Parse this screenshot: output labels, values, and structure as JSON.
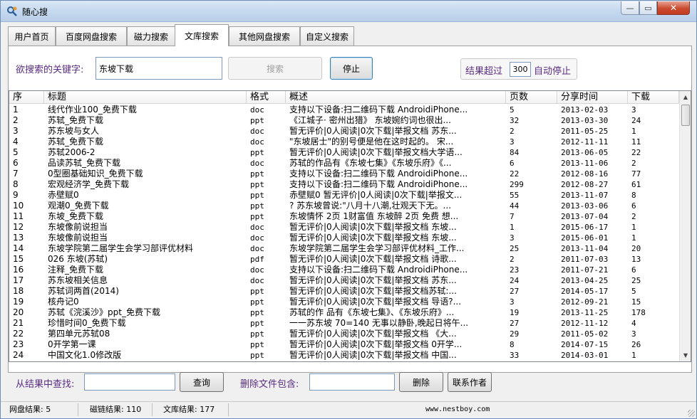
{
  "window": {
    "title": "随心搜",
    "controls": {
      "minimize": "—",
      "maximize": "▭",
      "close": "✕"
    }
  },
  "tabs": [
    {
      "label": "用户首页",
      "active": false
    },
    {
      "label": "百度网盘搜索",
      "active": false
    },
    {
      "label": "磁力搜索",
      "active": false
    },
    {
      "label": "文库搜索",
      "active": true
    },
    {
      "label": "其他网盘搜索",
      "active": false
    },
    {
      "label": "自定义搜索",
      "active": false
    }
  ],
  "search": {
    "label": "欲搜索的关键字:",
    "value": "东坡下载",
    "search_button": "搜索",
    "stop_button": "停止",
    "limit_prefix": "结果超过",
    "limit_value": "300",
    "limit_suffix": "自动停止"
  },
  "grid": {
    "columns": [
      "序",
      "标题",
      "格式",
      "概述",
      "页数",
      "分享时间",
      "下载"
    ],
    "rows": [
      [
        "1",
        "线代作业100_免费下载",
        "doc",
        "支持以下设备:扫二维码下载 AndroidiPhone...",
        "5",
        "2013-02-03",
        "3"
      ],
      [
        "2",
        "苏轼_免费下载",
        "ppt",
        "《江城子· 密州出猎》 东坡婉约词也很出...",
        "32",
        "2013-03-30",
        "24"
      ],
      [
        "3",
        "苏东坡与女人",
        "doc",
        "暂无评价|0人阅读|0次下载|举报文档 苏东...",
        "2",
        "2011-05-25",
        "1"
      ],
      [
        "4",
        "苏轼_免费下载",
        "doc",
        "\"东坡居士\"的别号便是他在这时起的。 宋...",
        "3",
        "2012-11-11",
        "11"
      ],
      [
        "5",
        "苏轼2006-2",
        "ppt",
        "暂无评价|0人阅读|0次下载|举报文档大学语...",
        "84",
        "2013-06-05",
        "22"
      ],
      [
        "6",
        "品读苏轼_免费下载",
        "doc",
        "苏轼的作品有《东坡七集》《东坡乐府》《...",
        "6",
        "2013-11-06",
        "2"
      ],
      [
        "7",
        "0型圈基础知识_免费下载",
        "ppt",
        "支持以下设备:扫二维码下载 AndroidiPhone...",
        "22",
        "2012-08-16",
        "77"
      ],
      [
        "8",
        "宏观经济学_免费下载",
        "ppt",
        "支持以下设备:扫二维码下载 AndroidiPhone...",
        "299",
        "2012-08-27",
        "61"
      ],
      [
        "9",
        "赤壁赋0",
        "ppt",
        "赤壁赋0 暂无评价|0人阅读|0次下载|举报文...",
        "55",
        "2013-11-07",
        "8"
      ],
      [
        "10",
        "观潮0_免费下载",
        "ppt",
        "? 苏东坡曾说:\"八月十八潮,壮观天下无。...",
        "44",
        "2013-03-06",
        "6"
      ],
      [
        "11",
        "东坡_免费下载",
        "ppt",
        "东坡情怀 2页 1财富值 东坡醉 2页 免费 想...",
        "7",
        "2013-07-04",
        "2"
      ],
      [
        "12",
        "东坡像前说担当",
        "doc",
        "暂无评价|0人阅读|0次下载|举报文档 东坡...",
        "1",
        "2015-06-17",
        "1"
      ],
      [
        "13",
        "东坡像前说担当",
        "doc",
        "暂无评价|0人阅读|0次下载|举报文档 东坡...",
        "3",
        "2015-06-01",
        "1"
      ],
      [
        "14",
        "东坡学院第二届学生会学习部评优材料",
        "doc",
        "东坡学院第二届学生会学习部评优材料_工作...",
        "25",
        "2013-11-04",
        "20"
      ],
      [
        "15",
        "026 东坡(苏轼)",
        "pdf",
        "暂无评价|0人阅读|0次下载|举报文档 诗歌...",
        "2",
        "2011-07-03",
        "13"
      ],
      [
        "16",
        "注释_免费下载",
        "doc",
        "支持以下设备:扫二维码下载 AndroidiPhone...",
        "23",
        "2011-07-21",
        "6"
      ],
      [
        "17",
        "苏东坡相关信息",
        "doc",
        "暂无评价|0人阅读|0次下载|举报文档 苏东...",
        "24",
        "2013-04-25",
        "25"
      ],
      [
        "18",
        "苏轼词两首(2014)",
        "ppt",
        "暂无评价|0人阅读|0次下载|举报文档苏轼:...",
        "27",
        "2014-05-17",
        "5"
      ],
      [
        "19",
        "核舟记0",
        "ppt",
        "暂无评价|0人阅读|0次下载|举报文档 导语?...",
        "3",
        "2012-09-21",
        "15"
      ],
      [
        "20",
        "苏轼《浣溪沙》ppt_免费下载",
        "ppt",
        "苏轼的作 品有《东坡七集》、《东坡乐府》...",
        "19",
        "2013-11-25",
        "178"
      ],
      [
        "21",
        "珍惜时间0_免费下载",
        "ppt",
        "一一苏东坡 70=140 无事以静卧,晚起日将午...",
        "27",
        "2012-11-12",
        "4"
      ],
      [
        "22",
        "第四单元苏轼08",
        "ppt",
        "暂无评价|0人阅读|0次下载|举报文档 《大...",
        "29",
        "2011-05-02",
        "3"
      ],
      [
        "23",
        "0开学第一课",
        "ppt",
        "暂无评价|0人阅读|0次下载|举报文档 0开学...",
        "8",
        "2014-07-15",
        "26"
      ],
      [
        "24",
        "中国文化1.0修改版",
        "ppt",
        "暂无评价|0人阅读|0次下载|举报文档 中国...",
        "33",
        "2014-03-01",
        "1"
      ]
    ]
  },
  "filter": {
    "find_label": "从结果中查找:",
    "find_value": "",
    "query_button": "查询",
    "delete_label": "删除文件包含:",
    "delete_value": "",
    "delete_button": "删除",
    "contact_button": "联系作者"
  },
  "status": {
    "pan": "网盘结果: 5",
    "magnet": "磁链结果: 110",
    "wenku": "文库结果: 177",
    "url": "www.nestboy.com"
  }
}
